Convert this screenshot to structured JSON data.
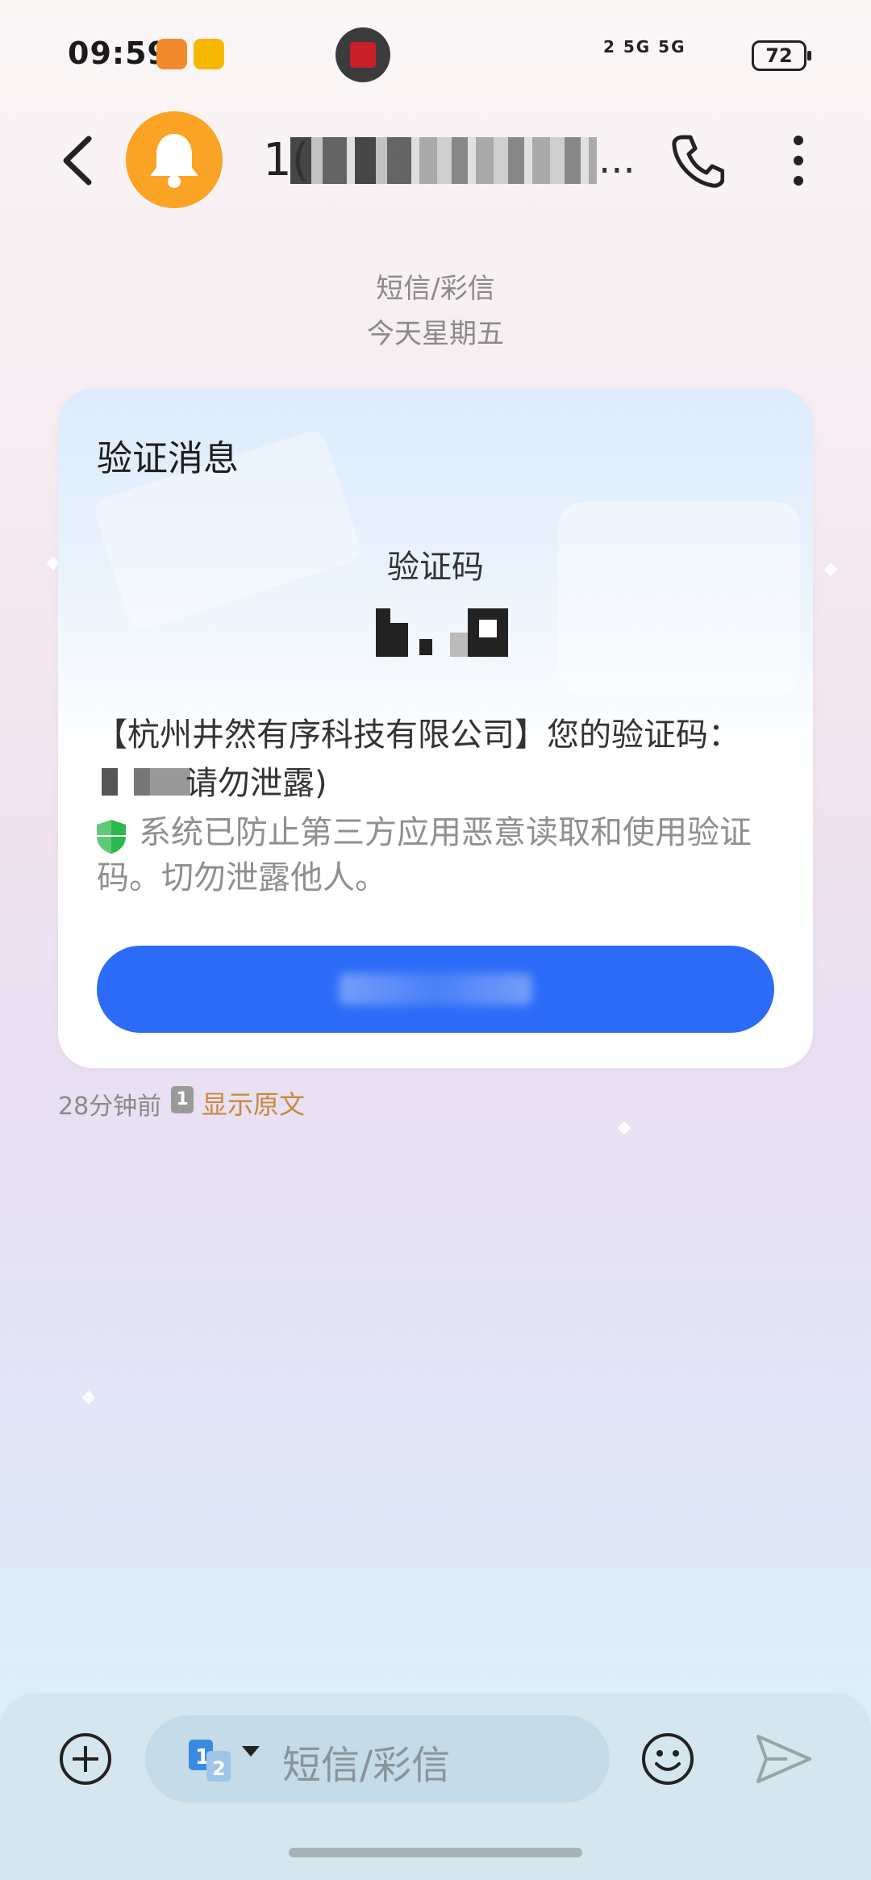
{
  "status_bar": {
    "time": "09:59",
    "signal_text": "2 5G 5G",
    "battery": "72"
  },
  "header": {
    "contact_visible": "1(",
    "contact_trailing": "..."
  },
  "thread": {
    "message_type": "短信/彩信",
    "date": "今天星期五"
  },
  "card": {
    "title": "验证消息",
    "code_label": "验证码",
    "body_line1": "【杭州井然有序科技有限公司】您的验证码：",
    "body_line2": "请勿泄露)",
    "safety_note": "系统已防止第三方应用恶意读取和使用验证码。切勿泄露他人。"
  },
  "meta": {
    "time_ago": "28分钟前",
    "sim_badge": "1",
    "show_original": "显示原文"
  },
  "composer": {
    "placeholder": "短信/彩信",
    "sim_icon": "sim-1-2-icon"
  },
  "colors": {
    "accent_blue": "#2b6bf7",
    "avatar_orange": "#fba324",
    "link_orange": "#c78a3c",
    "safe_green": "#2db84d"
  }
}
